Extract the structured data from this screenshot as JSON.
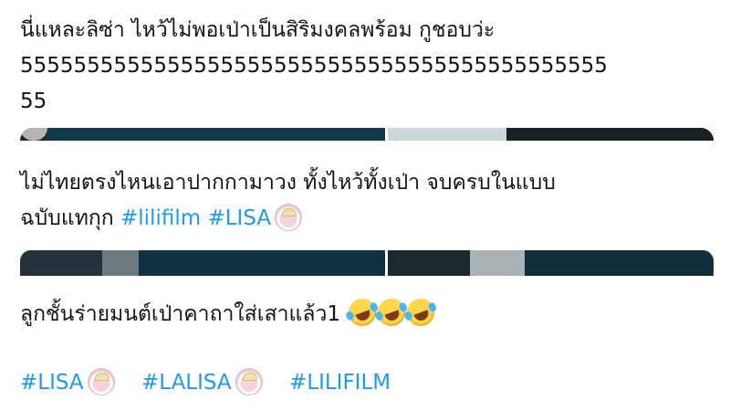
{
  "post1": {
    "line1": "นี่แหละลิซ่า ไหว้ไม่พอเป่าเป็นสิริมงคลพร้อม กูชอบว่ะ",
    "line2": "55555555555555555555555555555555555555555555",
    "line3": "55"
  },
  "post2": {
    "line1": "ไม่ไทยตรงไหนเอาปากกามาวง ทั้งไหว้ทั้งเป่า จบครบในแบบ",
    "line2_text": "ฉบับแทกุก ",
    "hashtag1": "#lilifilm",
    "hashtag2": "#LISA"
  },
  "post3": {
    "text": "ลูกชั้นร่ายมนต์เป่าคาถาใส่เสาแล้ว1"
  },
  "hashtags": {
    "tag1": "#LISA",
    "tag2": "#LALISA",
    "tag3": "#LILIFILM"
  },
  "icons": {
    "badge": "lisa-sticker-icon",
    "emoji": "rolling-on-floor-laughing-emoji"
  },
  "colors": {
    "hashtag": "#1d9bf0",
    "text": "#0f1419",
    "media_dark": "#1f2c33"
  }
}
